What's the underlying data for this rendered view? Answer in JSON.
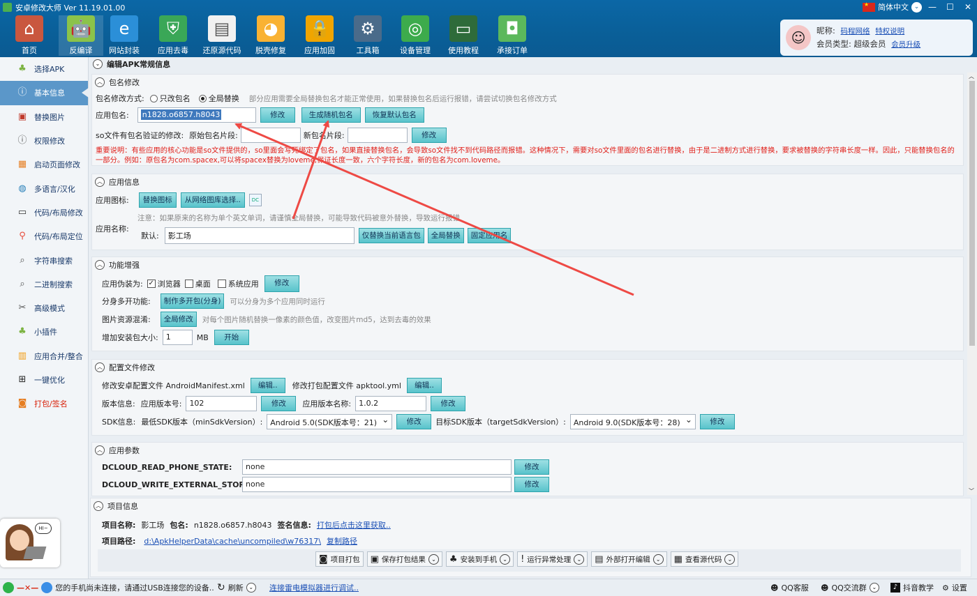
{
  "window": {
    "title": "安卓修改大师 Ver 11.19.01.00",
    "language": "简体中文"
  },
  "topnav": [
    {
      "label": "首页",
      "icon": "house-icon"
    },
    {
      "label": "反编译",
      "icon": "android-icon"
    },
    {
      "label": "网站封装",
      "icon": "ie-icon"
    },
    {
      "label": "应用去毒",
      "icon": "shield-icon"
    },
    {
      "label": "还原源代码",
      "icon": "document-icon"
    },
    {
      "label": "脱壳修复",
      "icon": "windows-ball-icon"
    },
    {
      "label": "应用加固",
      "icon": "lock-icon"
    },
    {
      "label": "工具箱",
      "icon": "toolbox-icon"
    },
    {
      "label": "设备管理",
      "icon": "radar-icon"
    },
    {
      "label": "使用教程",
      "icon": "chalkboard-icon"
    },
    {
      "label": "承接订单",
      "icon": "bag-icon"
    }
  ],
  "user": {
    "nick_label": "昵称:",
    "nick": "码程网络",
    "privilege": "特权说明",
    "type_label": "会员类型:",
    "type": "超级会员",
    "upgrade": "会员升级"
  },
  "sidebar": [
    {
      "label": "选择APK",
      "icon": "android-icon"
    },
    {
      "label": "基本信息",
      "icon": "info-android-icon"
    },
    {
      "label": "替换图片",
      "icon": "picture-icon"
    },
    {
      "label": "权限修改",
      "icon": "info-circle-icon"
    },
    {
      "label": "启动页面修改",
      "icon": "tiles-icon"
    },
    {
      "label": "多语言/汉化",
      "icon": "globe-icon"
    },
    {
      "label": "代码/布局修改",
      "icon": "code-icon"
    },
    {
      "label": "代码/布局定位",
      "icon": "location-icon"
    },
    {
      "label": "字符串搜索",
      "icon": "search-icon"
    },
    {
      "label": "二进制搜索",
      "icon": "search-icon"
    },
    {
      "label": "高级模式",
      "icon": "tools-icon"
    },
    {
      "label": "小插件",
      "icon": "android-icon"
    },
    {
      "label": "应用合并/整合",
      "icon": "merge-icon"
    },
    {
      "label": "一键优化",
      "icon": "grid-icon"
    },
    {
      "label": "打包/签名",
      "icon": "package-icon"
    }
  ],
  "edit_header": "编辑APK常规信息",
  "pkg": {
    "title": "包名修改",
    "mode_label": "包名修改方式:",
    "opt1": "只改包名",
    "opt2": "全局替换",
    "mode_note": "部分应用需要全局替换包名才能正常使用，如果替换包名后运行报错，请尝试切换包名修改方式",
    "name_label": "应用包名:",
    "name_value": "n1828.o6857.h8043",
    "btn_modify": "修改",
    "btn_random": "生成随机包名",
    "btn_restore": "恢复默认包名",
    "so_label": "so文件有包名验证的修改:",
    "so_orig_label": "原始包名片段:",
    "so_new_label": "新包名片段:",
    "so_btn": "修改",
    "warning": "重要说明：有些应用的核心功能是so文件提供的，so里面会写死绑定了包名，如果直接替换包名，会导致so文件找不到代码路径而报错。这种情况下，需要对so文件里面的包名进行替换，由于是二进制方式进行替换，要求被替换的字符串长度一样。因此，只能替换包名的一部分。例如：原包名为com.spacex,可以将spacex替换为loveme,保证长度一致，六个字符长度，新的包名为com.loveme。"
  },
  "appinfo": {
    "title": "应用信息",
    "icon_label": "应用图标:",
    "btn_replace_icon": "替换图标",
    "btn_gallery": "从网络图库选择..",
    "name_note": "注意：如果原来的名称为单个英文单词，请谨慎全局替换，可能导致代码被意外替换，导致运行报错",
    "name_label": "应用名称:",
    "default_label": "默认:",
    "name_value": "影工场",
    "btn_cur_lang": "仅替换当前语言包",
    "btn_global": "全局替换",
    "btn_fixed": "固定应用名"
  },
  "enhance": {
    "title": "功能增强",
    "disguise_label": "应用伪装为:",
    "browser": "浏览器",
    "desktop": "桌面",
    "sysapp": "系统应用",
    "btn_modify": "修改",
    "clone_label": "分身多开功能:",
    "btn_clone": "制作多开包(分身)",
    "clone_note": "可以分身为多个应用同时运行",
    "img_label": "图片资源混淆:",
    "btn_img": "全局修改",
    "img_note": "对每个图片随机替换一像素的颜色值，改变图片md5，达到去毒的效果",
    "size_label": "增加安装包大小:",
    "size_value": "1",
    "size_unit": "MB",
    "btn_start": "开始"
  },
  "config": {
    "title": "配置文件修改",
    "manifest_label": "修改安卓配置文件 AndroidManifest.xml",
    "btn_edit1": "编辑..",
    "apktool_label": "修改打包配置文件 apktool.yml",
    "btn_edit2": "编辑..",
    "ver_label": "版本信息:",
    "ver_code_label": "应用版本号:",
    "ver_code": "102",
    "btn_mod1": "修改",
    "ver_name_label": "应用版本名称:",
    "ver_name": "1.0.2",
    "btn_mod2": "修改",
    "sdk_label": "SDK信息:",
    "min_label": "最低SDK版本（minSdkVersion）:",
    "min_value": "Android 5.0(SDK版本号：21)",
    "btn_mod3": "修改",
    "target_label": "目标SDK版本（targetSdkVersion）:",
    "target_value": "Android 9.0(SDK版本号：28)",
    "btn_mod4": "修改"
  },
  "params": {
    "title": "应用参数",
    "rows": [
      {
        "key": "DCLOUD_READ_PHONE_STATE:",
        "value": "none",
        "btn": "修改"
      },
      {
        "key": "DCLOUD_WRITE_EXTERNAL_STORAGE",
        "value": "none",
        "btn": "修改"
      }
    ]
  },
  "project": {
    "title": "项目信息",
    "name_label": "项目名称:",
    "name": "影工场",
    "pkg_label": "包名:",
    "pkg": "n1828.o6857.h8043",
    "sign_label": "签名信息:",
    "sign_link": "打包后点击这里获取..",
    "path_label": "项目路径:",
    "path": "d:\\ApkHelperData\\cache\\uncompiled\\w76317\\",
    "copy_path": "复制路径",
    "buttons": [
      {
        "label": "项目打包",
        "icon": "package-icon",
        "dd": false
      },
      {
        "label": "保存打包结果",
        "icon": "save-icon",
        "dd": true
      },
      {
        "label": "安装到手机",
        "icon": "android-icon",
        "dd": true
      },
      {
        "label": "运行异常处理",
        "icon": "alert-icon",
        "dd": true
      },
      {
        "label": "外部打开编辑",
        "icon": "file-icon",
        "dd": true
      },
      {
        "label": "查看源代码",
        "icon": "code-file-icon",
        "dd": true
      }
    ]
  },
  "status": {
    "phone_text": "您的手机尚未连接，请通过USB连接您的设备..",
    "refresh": "刷新",
    "emulator_link": "连接雷电模拟器进行调试..",
    "qq_service": "QQ客服",
    "qq_group": "QQ交流群",
    "douyin": "抖音教学",
    "settings": "设置"
  },
  "colors": {
    "accent": "#0b67a6",
    "button": "#58c3cb",
    "warning": "#e0201a",
    "arrow": "#ee4a45"
  }
}
